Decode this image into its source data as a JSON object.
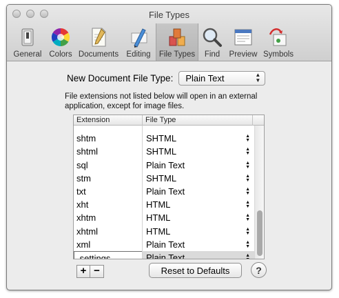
{
  "window": {
    "title": "File Types"
  },
  "toolbar": {
    "items": [
      {
        "label": "General",
        "icon": "switch-icon",
        "width": 52
      },
      {
        "label": "Colors",
        "icon": "color-wheel-icon",
        "width": 44
      },
      {
        "label": "Documents",
        "icon": "document-pen-icon",
        "width": 66
      },
      {
        "label": "Editing",
        "icon": "pencil-ruler-icon",
        "width": 50
      },
      {
        "label": "File Types",
        "icon": "file-types-icon",
        "width": 62,
        "selected": true
      },
      {
        "label": "Find",
        "icon": "magnifier-icon",
        "width": 40
      },
      {
        "label": "Preview",
        "icon": "browser-window-icon",
        "width": 50
      },
      {
        "label": "Symbols",
        "icon": "symbols-icon",
        "width": 52
      }
    ]
  },
  "new_doc": {
    "label": "New Document File Type:",
    "value": "Plain Text"
  },
  "info_text": "File extensions not listed below will open in an external application, except for image files.",
  "table": {
    "headers": [
      "Extension",
      "File Type"
    ],
    "rows": [
      {
        "ext": "",
        "type": ""
      },
      {
        "ext": "shtm",
        "type": "SHTML"
      },
      {
        "ext": "shtml",
        "type": "SHTML"
      },
      {
        "ext": "sql",
        "type": "Plain Text"
      },
      {
        "ext": "stm",
        "type": "SHTML"
      },
      {
        "ext": "txt",
        "type": "Plain Text"
      },
      {
        "ext": "xht",
        "type": "HTML"
      },
      {
        "ext": "xhtm",
        "type": "HTML"
      },
      {
        "ext": "xhtml",
        "type": "HTML"
      },
      {
        "ext": "xml",
        "type": "Plain Text"
      },
      {
        "ext": ".settings",
        "type": "Plain Text",
        "selected": true,
        "editing": true
      }
    ]
  },
  "buttons": {
    "add": "+",
    "remove": "−",
    "reset": "Reset to Defaults",
    "help": "?"
  },
  "colors": {
    "titlebar_top": "#e8e8e8",
    "titlebar_bottom": "#cfcfcf",
    "selected_row": "#dadada"
  }
}
